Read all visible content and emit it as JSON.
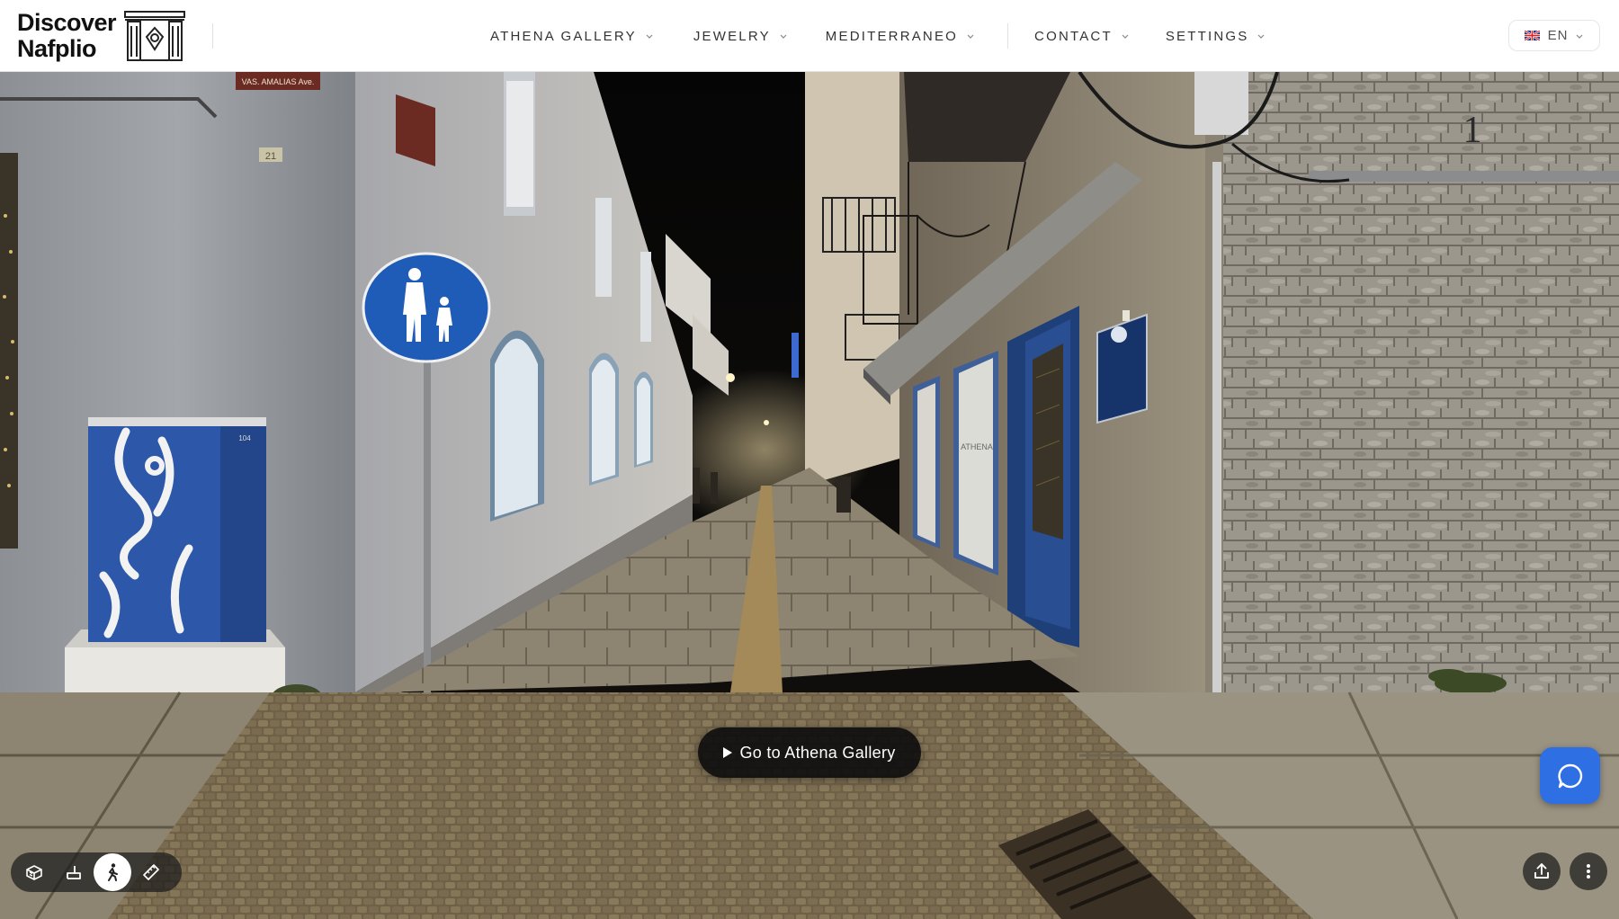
{
  "brand": {
    "line1": "Discover",
    "line2": "Nafplio"
  },
  "nav": {
    "items": [
      {
        "label": "ATHENA GALLERY"
      },
      {
        "label": "JEWELRY"
      },
      {
        "label": "MEDITERRANEO"
      },
      {
        "label": "CONTACT"
      },
      {
        "label": "SETTINGS"
      }
    ]
  },
  "language": {
    "code": "EN"
  },
  "scene": {
    "street_sign": "VAS. AMALIAS Ave.",
    "house_number": "21",
    "door_number": "1",
    "cabinet_number": "104",
    "shop_sign": "ATHENA"
  },
  "cta": {
    "label": "Go to Athena Gallery"
  },
  "toolbar": {
    "tools": [
      {
        "icon": "dollhouse-icon"
      },
      {
        "icon": "floorplan-icon"
      },
      {
        "icon": "walk-icon",
        "active": true
      },
      {
        "icon": "measure-icon"
      }
    ]
  },
  "colors": {
    "chat_button": "#2f6fe4",
    "header_bg": "#ffffff",
    "cta_bg": "#0e0e0e"
  }
}
